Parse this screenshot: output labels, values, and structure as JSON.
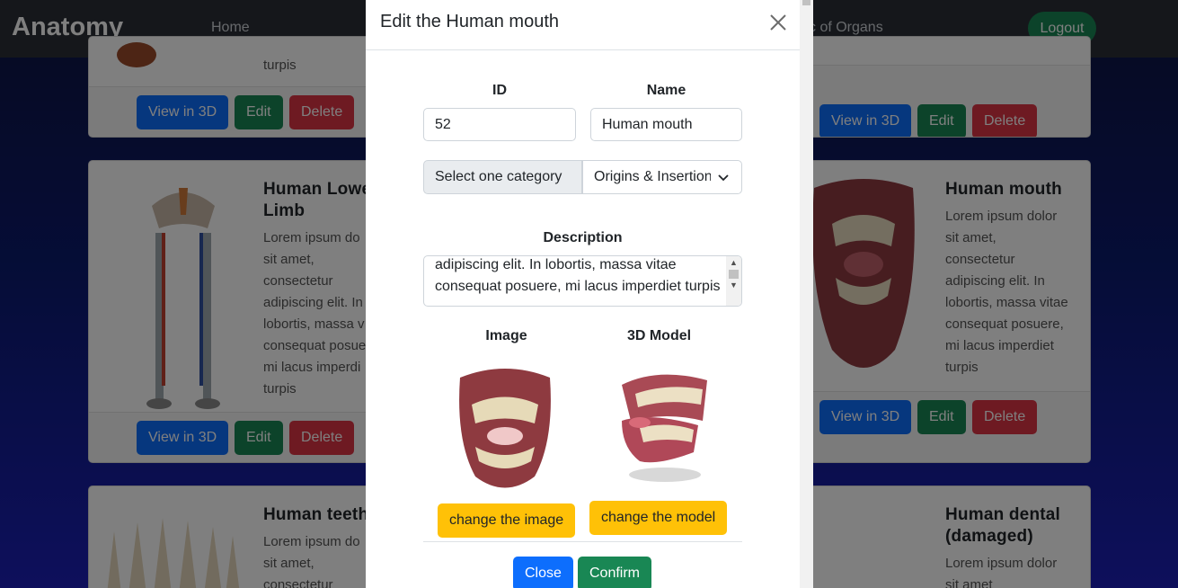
{
  "navbar": {
    "brand": "Anatomy",
    "links": [
      "Home",
      "c of Organs"
    ],
    "logout_label": "Logout"
  },
  "cards": [
    {
      "title": "",
      "text": "turpis",
      "buttons": [
        "View in 3D",
        "Edit",
        "Delete"
      ]
    },
    {
      "title": "",
      "text": "",
      "buttons": [
        "View in 3D",
        "Edit",
        "Delete"
      ]
    },
    {
      "title": "Human Lowe\nLimb",
      "text": "Lorem ipsum do\nsit amet,\nconsectetur\nadipiscing elit. In\nlobortis, massa v\nconsequat posue\nmi lacus imperdi\nturpis",
      "buttons": [
        "View in 3D",
        "Edit",
        "Delete"
      ]
    },
    {
      "title": "Human mouth",
      "text": "Lorem ipsum dolor\nsit amet,\nconsectetur\nadipiscing elit. In\nlobortis, massa vitae\nconsequat posuere,\nmi lacus imperdiet\nturpis",
      "buttons": [
        "View in 3D",
        "Edit",
        "Delete"
      ]
    },
    {
      "title": "Human teeth",
      "text": "Lorem ipsum do\nsit amet,\nconsectetur",
      "buttons": []
    },
    {
      "title": "Human dental\n(damaged)",
      "text": "Lorem ipsum dolor\nsit amet",
      "buttons": []
    }
  ],
  "modal": {
    "title": "Edit the Human mouth",
    "id_label": "ID",
    "id_value": "52",
    "name_label": "Name",
    "name_value": "Human mouth",
    "category_label": "Select one category",
    "category_value": "Origins & Insertions",
    "description_label": "Description",
    "description_value": "adipiscing elit. In lobortis, massa vitae consequat posuere, mi lacus imperdiet turpis",
    "image_label": "Image",
    "model_label": "3D Model",
    "change_image_label": "change the image",
    "change_model_label": "change the model",
    "close_label": "Close",
    "confirm_label": "Confirm"
  },
  "colors": {
    "primary": "#0d6efd",
    "success": "#198754",
    "danger": "#dc3545",
    "warning": "#ffc107",
    "navbar": "#2a2f36"
  }
}
